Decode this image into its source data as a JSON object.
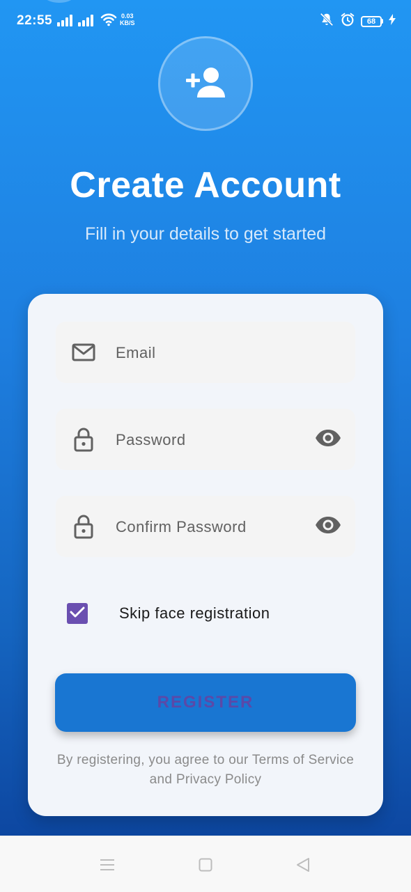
{
  "status_bar": {
    "time": "22:55",
    "net_speed_value": "0.03",
    "net_speed_unit": "KB/S",
    "battery_level": "68"
  },
  "header": {
    "title": "Create Account",
    "subtitle": "Fill in your details to get started"
  },
  "form": {
    "email": {
      "placeholder": "Email",
      "value": ""
    },
    "password": {
      "placeholder": "Password",
      "value": ""
    },
    "confirm_password": {
      "placeholder": "Confirm Password",
      "value": ""
    },
    "skip_face": {
      "label": "Skip face registration",
      "checked": true
    },
    "register_label": "REGISTER",
    "terms_text": "By registering, you agree to our Terms of Service and Privacy Policy"
  },
  "icons": {
    "avatar": "person-add-icon",
    "email": "mail-icon",
    "password": "lock-icon",
    "visibility": "eye-icon",
    "nav": [
      "menu-icon",
      "home-square-icon",
      "back-triangle-icon"
    ]
  },
  "colors": {
    "gradient_top": "#2196f3",
    "gradient_bottom": "#0d47a1",
    "card": "#f2f5fa",
    "field": "#f4f4f4",
    "checkbox": "#6a4fb0",
    "button": "#1976d2",
    "button_text": "#5b49a8"
  }
}
